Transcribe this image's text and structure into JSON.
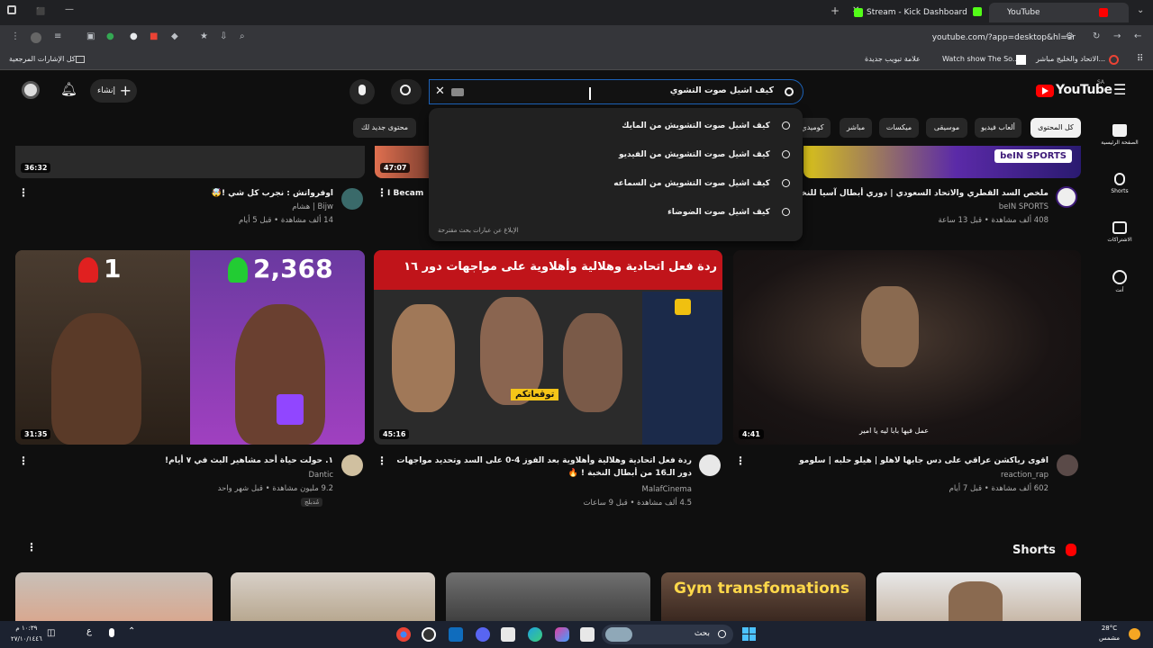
{
  "browser": {
    "tabs": [
      {
        "label": "Stream - Kick Dashboard",
        "active": false,
        "color": "#53fc18"
      },
      {
        "label": "YouTube",
        "active": true,
        "color": "#ff0000"
      }
    ],
    "url": "youtube.com/?app=desktop&hl=ar",
    "bookmarks": [
      "كل الإشارات المرجعية",
      "علامة تبويب جديدة",
      "Watch show The So...",
      "الاتحاد والخليج مباشر..."
    ]
  },
  "header": {
    "logo": "YouTube",
    "logo_region": "SA",
    "create_label": "إنشاء",
    "search_value": "كيف اشيل صوت التشوي",
    "suggestions": [
      "كيف اشيل صوت التشويش من المايك",
      "كيف اشيل صوت التشويش من الفيديو",
      "كيف اشيل صوت التشويش من السماعه",
      "كيف اشيل صوت الضوضاء"
    ],
    "report_label": "الإبلاغ عن عبارات بحث مقترحة"
  },
  "chips": [
    "كل المحتوى",
    "ألعاب فيديو",
    "موسيقى",
    "ميكسات",
    "مباشر",
    "كوميدي",
    "محتوى جديد لك"
  ],
  "sidenav": [
    {
      "label": "الصفحة الرئيسية",
      "icon": "home-icon"
    },
    {
      "label": "Shorts",
      "icon": "shorts-icon"
    },
    {
      "label": "الاشتراكات",
      "icon": "subscriptions-icon"
    },
    {
      "label": "أنت",
      "icon": "you-icon"
    }
  ],
  "row1": [
    {
      "title": "ملخص السد القطري والاتحاد السعودي | دوري أبطال آسيا للنخبة - الجولة",
      "channel": "beIN SPORTS",
      "meta": "408 ألف مشاهدة • قبل 13 ساعة",
      "thumb_text": "beIN SPORTS"
    },
    {
      "title": "I Becam",
      "channel": "",
      "meta": "",
      "duration": "47:07"
    },
    {
      "title": "اوفرواتش : نجرب كل شي !🤯",
      "channel": "Bijw | هشام",
      "meta": "14 ألف مشاهدة • قبل 5 أيام",
      "duration": "36:32"
    }
  ],
  "row2": [
    {
      "title": "اقوى رياكشن عراقي على دس جابها لاهلو | هيلو حلبه | سلومو",
      "channel": "reaction_rap",
      "meta": "602 ألف مشاهدة • قبل 7 أيام",
      "duration": "4:41",
      "caption": "عمل فيها بابا ليه يا امير"
    },
    {
      "title": "ردة فعل اتحادية وهلالية وأهلاوية بعد الفوز 4-0 على السد وتحديد مواجهات دور الـ16 من أبطال النخبة ! 🔥",
      "channel": "MalafCinema",
      "meta": "4.5 ألف مشاهدة • قبل 9 ساعات",
      "duration": "45:16",
      "banner": "ردة فعل اتحادية وهلالية وأهلاوية على مواجهات دور ١٦",
      "badge": "توقعاتكم"
    },
    {
      "title": "١. حولت حياة أحد مشاهير البث في ٧ أيام!",
      "channel": "Dantic",
      "meta": "9.2 مليون مشاهدة • قبل شهر واحد",
      "duration": "31:35",
      "extra": "مُدبلج",
      "count_left": "1",
      "count_right": "2,368"
    }
  ],
  "shorts": {
    "title": "Shorts",
    "first_text": "Gym transfomations"
  },
  "taskbar": {
    "weather": "28°C",
    "weather_sub": "مشمس",
    "time": "١٠:٣٩ م",
    "date": "٢٧/١٠/١٤٤٦",
    "search_label": "بحث",
    "lang": "ع"
  }
}
